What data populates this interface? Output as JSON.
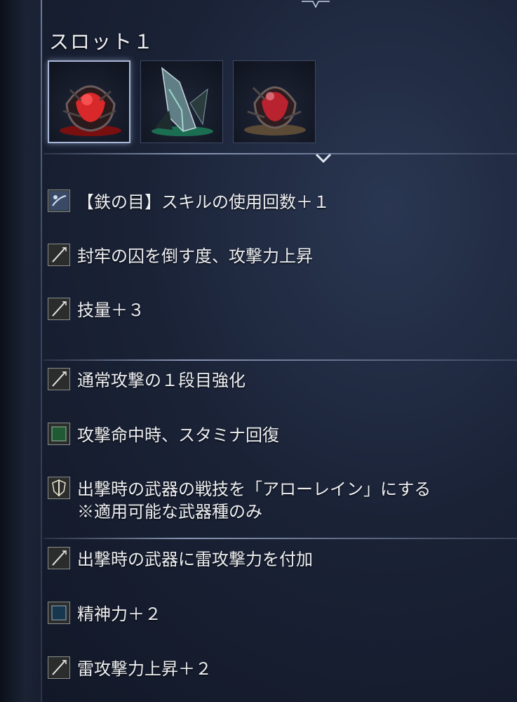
{
  "slot": {
    "title": "スロット１",
    "gems": [
      {
        "icon": "red-relic-icon",
        "color": "#d8282a",
        "selected": true
      },
      {
        "icon": "green-crystal-relic-icon",
        "color": "#3fae82",
        "selected": false
      },
      {
        "icon": "red-relic-icon",
        "color": "#b8232f",
        "selected": false
      }
    ]
  },
  "effects": [
    {
      "icon": "arrow-hand-icon",
      "text": "【鉄の目】スキルの使用回数＋１"
    },
    {
      "icon": "sword-icon",
      "text": "封牢の囚を倒す度、攻撃力上昇"
    },
    {
      "icon": "sword-icon",
      "text": "技量＋３"
    },
    {
      "icon": "sword-icon",
      "text": "通常攻撃の１段目強化"
    },
    {
      "icon": "green-square-icon",
      "text": "攻撃命中時、スタミナ回復"
    },
    {
      "icon": "shield-sword-icon",
      "text": "出撃時の武器の戦技を「アローレイン」にする",
      "text2": "※適用可能な武器種のみ"
    },
    {
      "icon": "sword-icon",
      "text": "出撃時の武器に雷攻撃力を付加"
    },
    {
      "icon": "blue-square-icon",
      "text": "精神力＋２"
    },
    {
      "icon": "sword-icon",
      "text": "雷攻撃力上昇＋２"
    }
  ]
}
